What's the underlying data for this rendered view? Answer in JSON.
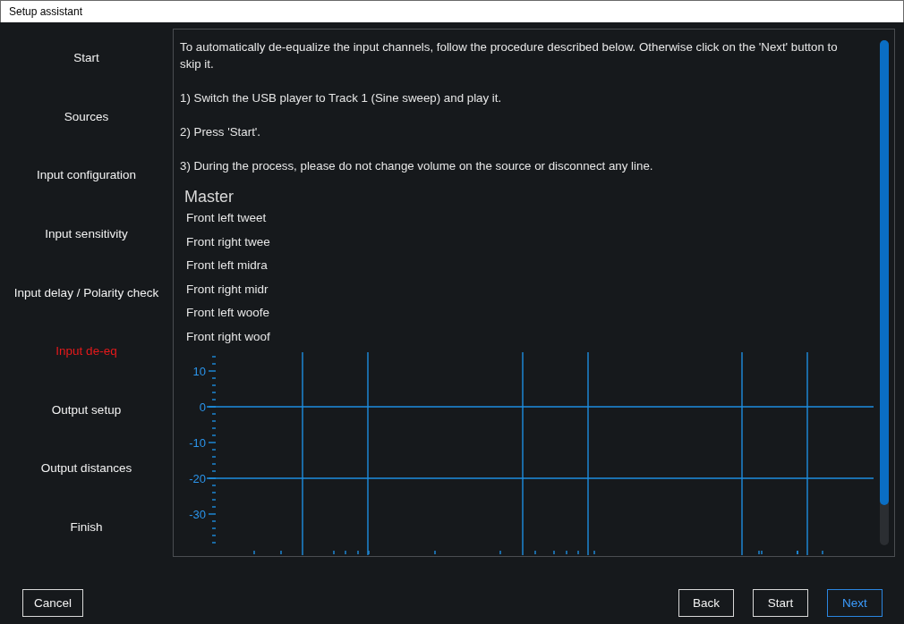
{
  "window": {
    "title": "Setup assistant"
  },
  "sidebar": {
    "items": [
      {
        "label": "Start",
        "selected": false
      },
      {
        "label": "Sources",
        "selected": false
      },
      {
        "label": "Input configuration",
        "selected": false
      },
      {
        "label": "Input sensitivity",
        "selected": false
      },
      {
        "label": "Input delay / Polarity check",
        "selected": false
      },
      {
        "label": "Input de-eq",
        "selected": true
      },
      {
        "label": "Output setup",
        "selected": false
      },
      {
        "label": "Output distances",
        "selected": false
      },
      {
        "label": "Finish",
        "selected": false
      }
    ]
  },
  "instructions": [
    "To automatically de-equalize the input channels, follow the procedure described below. Otherwise click on the 'Next' button to skip it.",
    "1) Switch the USB player to Track 1 (Sine sweep) and play it.",
    "2) Press 'Start'.",
    "3) During the process, please do not change volume on the source or disconnect any line."
  ],
  "channel_group": {
    "title": "Master",
    "channels": [
      "Front left tweet",
      "Front right twee",
      "Front left midra",
      "Front right midr",
      "Front left woofe",
      "Front right woof"
    ]
  },
  "graph": {
    "y_labels": [
      "10",
      "0",
      "-10",
      "-20",
      "-30"
    ]
  },
  "buttons_left": [
    {
      "label": "Cancel",
      "default": false
    }
  ],
  "buttons_right": [
    {
      "label": "Back",
      "default": false
    },
    {
      "label": "Start",
      "default": false
    },
    {
      "label": "Next",
      "default": true
    }
  ]
}
